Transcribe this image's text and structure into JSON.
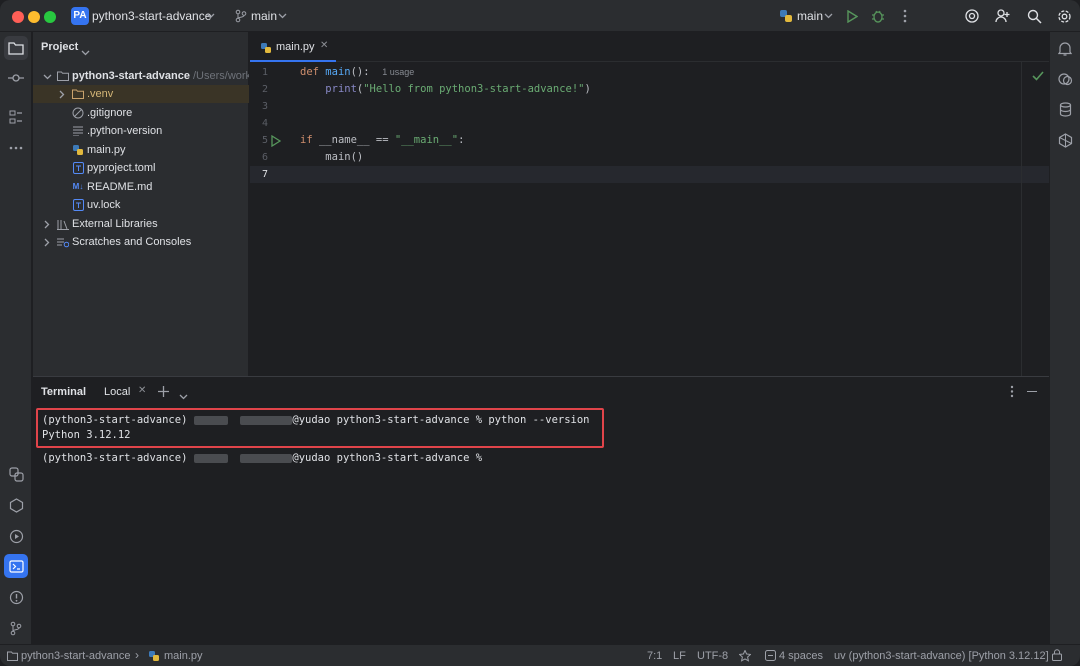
{
  "titlebar": {
    "project_badge": "PA",
    "project_name": "python3-start-advance",
    "branch": "main",
    "run_config": "main"
  },
  "project_panel": {
    "title": "Project",
    "root_name": "python3-start-advance",
    "root_path": "/Users/work",
    "items": [
      {
        "label": ".venv",
        "icon": "folder-icon"
      },
      {
        "label": ".gitignore",
        "icon": "ignore-icon"
      },
      {
        "label": ".python-version",
        "icon": "text-file-icon"
      },
      {
        "label": "main.py",
        "icon": "python-file-icon"
      },
      {
        "label": "pyproject.toml",
        "icon": "toml-file-icon"
      },
      {
        "label": "README.md",
        "icon": "markdown-file-icon"
      },
      {
        "label": "uv.lock",
        "icon": "lock-file-icon"
      }
    ],
    "external_libraries": "External Libraries",
    "scratches": "Scratches and Consoles"
  },
  "editor": {
    "tab_label": "main.py",
    "usage_hint": "1 usage",
    "line_numbers": [
      "1",
      "2",
      "3",
      "4",
      "5",
      "6",
      "7"
    ],
    "code": {
      "l1_kw": "def",
      "l1_fn": "main",
      "l1_rest": "():",
      "l2_fn": "print",
      "l2_str": "\"Hello from python3-start-advance!\"",
      "l5_kw": "if",
      "l5_mid": "__name__ == ",
      "l5_str": "\"__main__\"",
      "l5_end": ":",
      "l6": "main()"
    }
  },
  "terminal": {
    "title": "Terminal",
    "tab": "Local",
    "line1_prefix": "(python3-start-advance)",
    "line1_suffix": "@yudao python3-start-advance % python --version",
    "line2": "Python 3.12.12",
    "line3_prefix": "(python3-start-advance)",
    "line3_suffix": "@yudao python3-start-advance %"
  },
  "statusbar": {
    "breadcrumb_project": "python3-start-advance",
    "breadcrumb_file": "main.py",
    "position": "7:1",
    "line_sep": "LF",
    "encoding": "UTF-8",
    "indent": "4 spaces",
    "interpreter": "uv (python3-start-advance) [Python 3.12.12]"
  },
  "colors": {
    "accent": "#3574f0",
    "highlight_box": "#e0444a",
    "run_green": "#57965c"
  }
}
